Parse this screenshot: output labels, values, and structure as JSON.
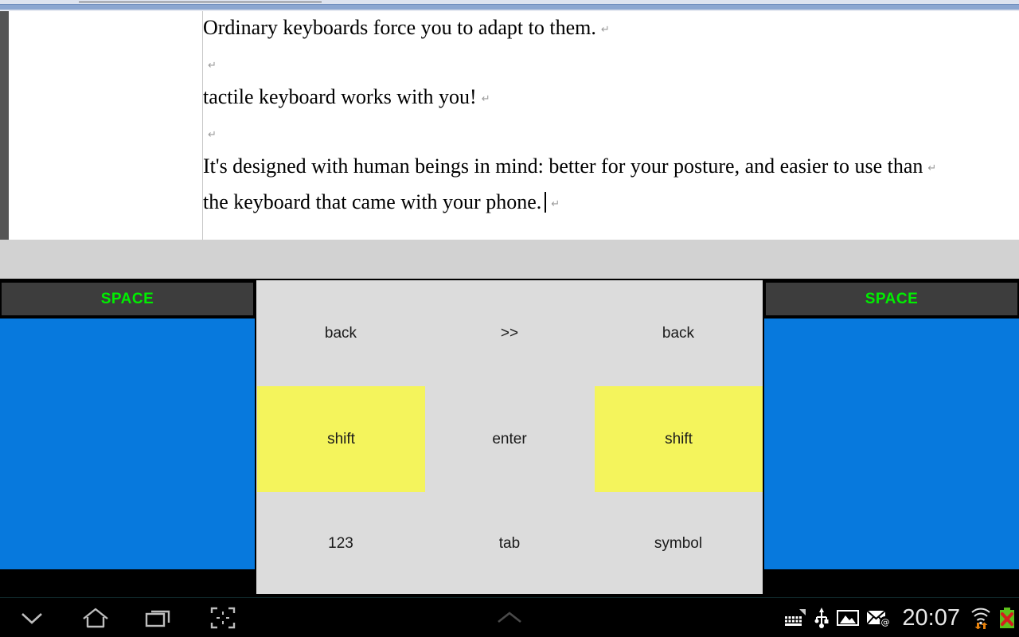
{
  "document": {
    "lines": [
      {
        "text": "Ordinary keyboards force you to adapt to them.",
        "pilcrow": "↵",
        "blank": false,
        "caret": false
      },
      {
        "text": "",
        "pilcrow": "↵",
        "blank": true,
        "caret": false
      },
      {
        "text": "tactile keyboard works with you!",
        "pilcrow": "↵",
        "blank": false,
        "caret": false
      },
      {
        "text": "",
        "pilcrow": "↵",
        "blank": true,
        "caret": false
      },
      {
        "text": "It's designed with human beings in mind: better for your posture, and easier to use than",
        "pilcrow": "↵",
        "blank": false,
        "caret": false
      },
      {
        "text": "the keyboard that came with your phone.",
        "pilcrow": "↵",
        "blank": false,
        "caret": true
      }
    ],
    "line_0": "Ordinary keyboards force you to adapt to them.",
    "line_2": "tactile keyboard works with you!",
    "line_4": "It's designed with human beings in mind: better for your posture, and easier to use than",
    "line_5": "the keyboard that came with your phone.",
    "pilcrow_glyph": "↵"
  },
  "keyboard": {
    "space_left_label": "SPACE",
    "space_right_label": "SPACE",
    "space_text_color": "#00ee00",
    "space_bg_color": "#3d3d3d",
    "side_panel_color": "#0779dd",
    "keypad_bg_color": "#dcdcdc",
    "shift_key_color": "#f4f45c",
    "rows": [
      {
        "keys": [
          {
            "label": "back",
            "name": "key-back-left",
            "highlight": false
          },
          {
            "label": ">>",
            "name": "key-next",
            "highlight": false
          },
          {
            "label": "back",
            "name": "key-back-right",
            "highlight": false
          }
        ]
      },
      {
        "keys": [
          {
            "label": "shift",
            "name": "key-shift-left",
            "highlight": true
          },
          {
            "label": "enter",
            "name": "key-enter",
            "highlight": false
          },
          {
            "label": "shift",
            "name": "key-shift-right",
            "highlight": true
          }
        ]
      },
      {
        "keys": [
          {
            "label": "123",
            "name": "key-123",
            "highlight": false
          },
          {
            "label": "tab",
            "name": "key-tab",
            "highlight": false
          },
          {
            "label": "symbol",
            "name": "key-symbol",
            "highlight": false
          }
        ]
      }
    ],
    "r1c1": "back",
    "r1c2": ">>",
    "r1c3": "back",
    "r2c1": "shift",
    "r2c2": "enter",
    "r2c3": "shift",
    "r3c1": "123",
    "r3c2": "tab",
    "r3c3": "symbol"
  },
  "navbar": {
    "buttons": [
      {
        "name": "hide-keyboard-icon",
        "label": "hide-keyboard"
      },
      {
        "name": "home-icon",
        "label": "home"
      },
      {
        "name": "recents-icon",
        "label": "recent-apps"
      },
      {
        "name": "screenshot-icon",
        "label": "screenshot"
      }
    ],
    "center_handle": "expand-chevron-up-icon"
  },
  "statusbar": {
    "clock": "20:07",
    "icons": [
      {
        "name": "keyboard-icon",
        "label": "keyboard-active"
      },
      {
        "name": "usb-icon",
        "label": "usb-connected"
      },
      {
        "name": "screenshot-saved-icon",
        "label": "image"
      },
      {
        "name": "email-icon",
        "label": "new-email"
      },
      {
        "name": "wifi-icon",
        "label": "wifi-transfer"
      },
      {
        "name": "battery-icon",
        "label": "battery-error"
      }
    ],
    "battery_color": "#5cc11a",
    "battery_error_color": "#d41e1e",
    "wifi_arrow_color": "#e8820c"
  }
}
